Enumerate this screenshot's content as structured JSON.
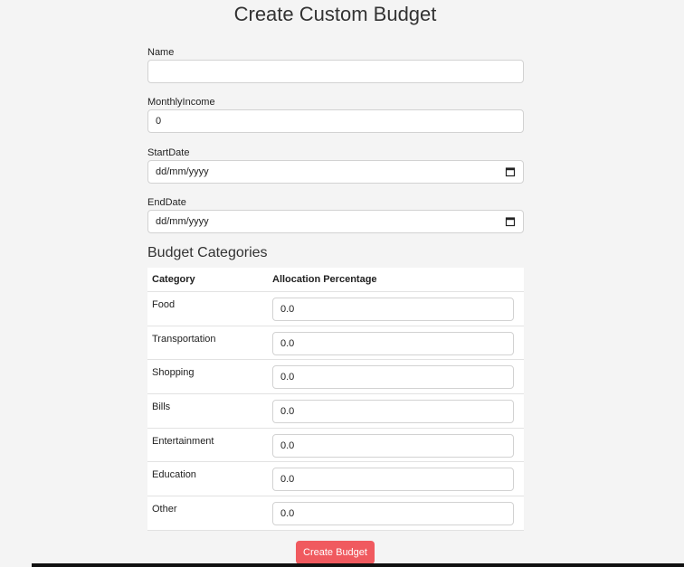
{
  "page": {
    "title": "Create Custom Budget"
  },
  "form": {
    "name": {
      "label": "Name",
      "value": ""
    },
    "monthly_income": {
      "label": "MonthlyIncome",
      "value": "0"
    },
    "start_date": {
      "label": "StartDate",
      "placeholder": "dd/mm/yyyy"
    },
    "end_date": {
      "label": "EndDate",
      "placeholder": "dd/mm/yyyy"
    }
  },
  "categories": {
    "title": "Budget Categories",
    "headers": {
      "category": "Category",
      "allocation": "Allocation Percentage"
    },
    "rows": [
      {
        "name": "Food",
        "value": "0.0"
      },
      {
        "name": "Transportation",
        "value": "0.0"
      },
      {
        "name": "Shopping",
        "value": "0.0"
      },
      {
        "name": "Bills",
        "value": "0.0"
      },
      {
        "name": "Entertainment",
        "value": "0.0"
      },
      {
        "name": "Education",
        "value": "0.0"
      },
      {
        "name": "Other",
        "value": "0.0"
      }
    ]
  },
  "actions": {
    "submit_label": "Create Budget"
  },
  "colors": {
    "background": "#f4f4f4",
    "submit_button": "#f05a5f",
    "input_border": "#d2d2d2"
  },
  "icons": {
    "date_picker": "calendar-icon"
  }
}
